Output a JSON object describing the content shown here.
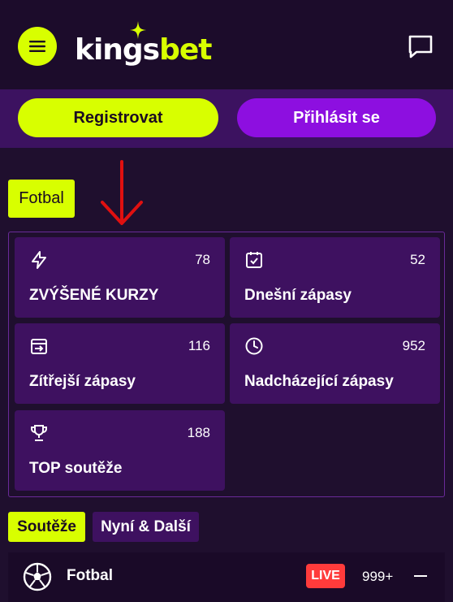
{
  "header": {
    "menu_icon": "hamburger-icon",
    "logo_text_main": "kings",
    "logo_text_accent": "bet",
    "chat_icon": "chat-icon"
  },
  "auth": {
    "register_label": "Registrovat",
    "login_label": "Přihlásit se"
  },
  "sport_filter": {
    "label": "Fotbal"
  },
  "tiles": [
    {
      "icon": "lightning-icon",
      "count": "78",
      "label": "ZVÝŠENÉ KURZY"
    },
    {
      "icon": "calendar-check-icon",
      "count": "52",
      "label": "Dnešní zápasy"
    },
    {
      "icon": "calendar-arrow-icon",
      "count": "116",
      "label": "Zítřejší zápasy"
    },
    {
      "icon": "clock-icon",
      "count": "952",
      "label": "Nadcházející zápasy"
    },
    {
      "icon": "trophy-icon",
      "count": "188",
      "label": "TOP soutěže"
    }
  ],
  "tabs": {
    "active": "Soutěže",
    "inactive": "Nyní & Další"
  },
  "sport_row": {
    "icon": "soccer-ball-icon",
    "name": "Fotbal",
    "live_badge": "LIVE",
    "count": "999+"
  },
  "colors": {
    "accent": "#d8ff00",
    "purple": "#8d0fe0",
    "tile_bg": "#3e1160",
    "live": "#ff3b3b"
  }
}
